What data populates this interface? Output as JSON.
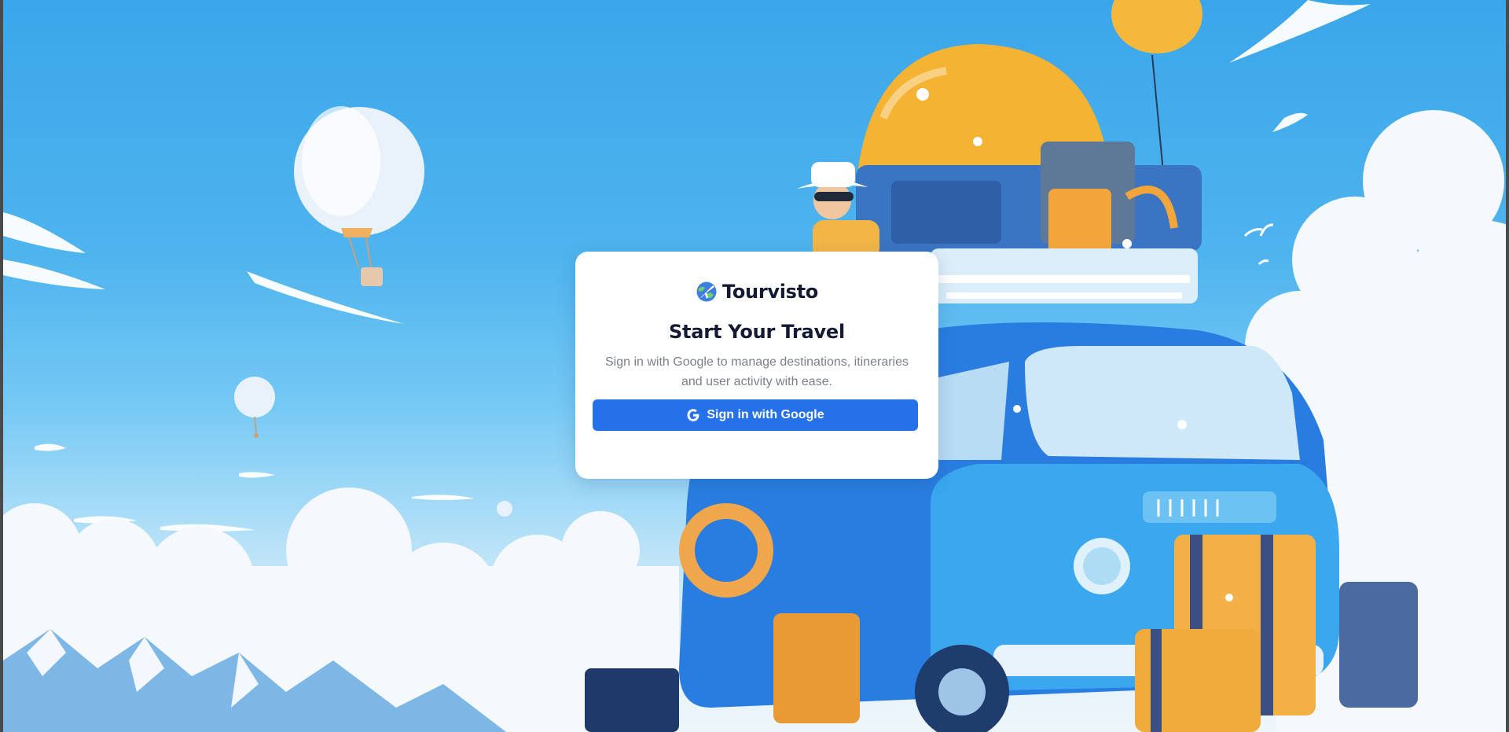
{
  "brand": {
    "name": "Tourvisto",
    "logo_icon": "globe-airplane-icon"
  },
  "auth": {
    "title": "Start Your Travel",
    "subtitle": "Sign in with Google to manage destinations, itineraries and user activity with ease.",
    "google_button_label": "Sign in with Google",
    "google_icon": "google-icon"
  },
  "colors": {
    "button": "#2471e9",
    "card": "#ffffff",
    "title": "#141a33",
    "subtitle": "#7b7f8e",
    "sky": "#3aa6ea"
  }
}
